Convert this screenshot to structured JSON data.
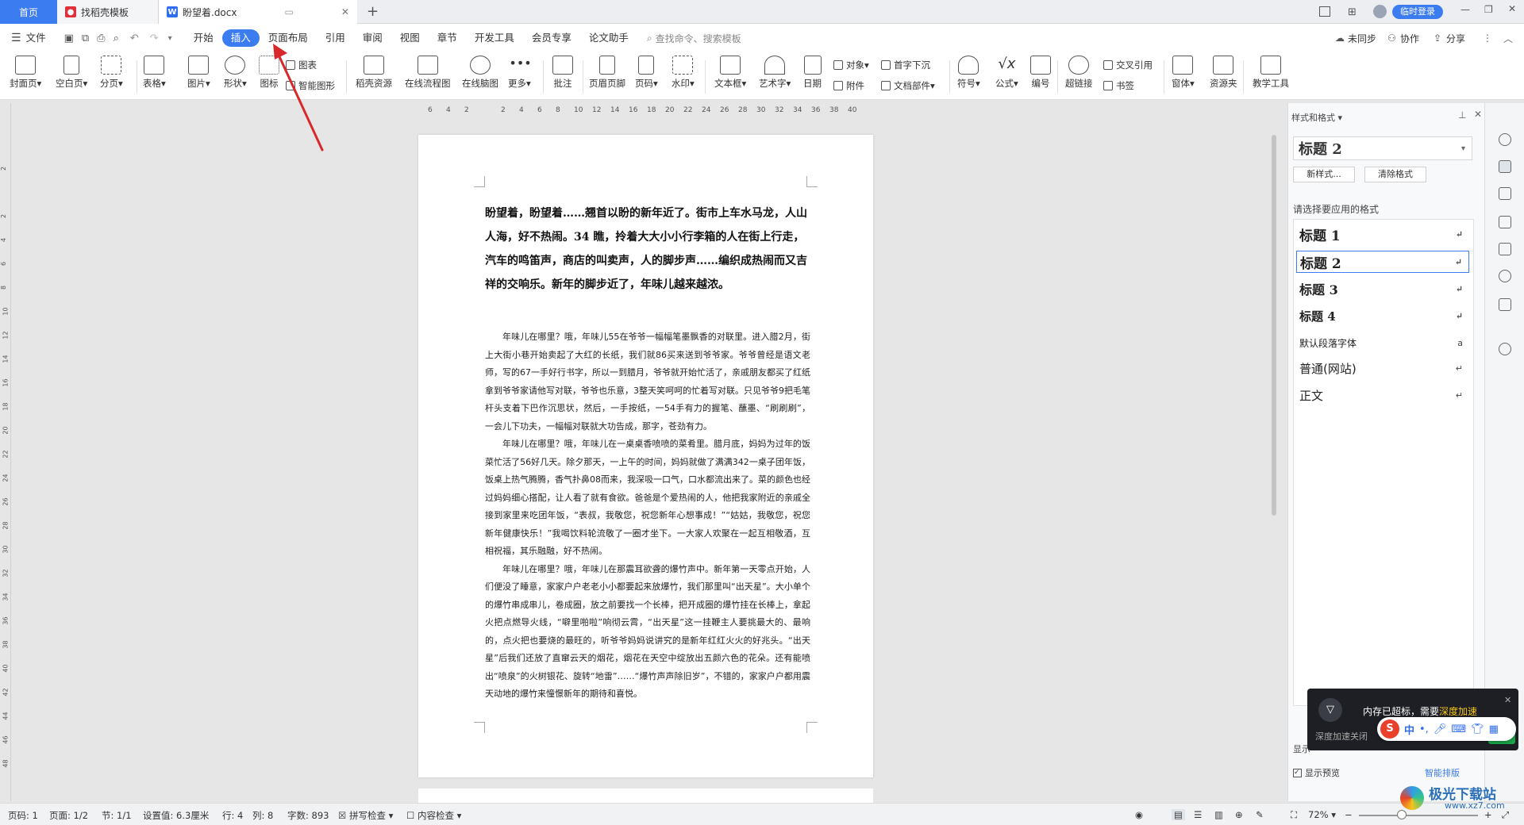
{
  "tabs": [
    {
      "label": "首页"
    },
    {
      "label": "找稻壳模板"
    },
    {
      "label": "盼望着.docx"
    }
  ],
  "titlebar": {
    "login_label": "临时登录",
    "new_tab": "+"
  },
  "menubar": {
    "file": "文件",
    "items": [
      "开始",
      "插入",
      "页面布局",
      "引用",
      "审阅",
      "视图",
      "章节",
      "开发工具",
      "会员专享",
      "论文助手"
    ],
    "active": "插入",
    "search_placeholder": "查找命令、搜索模板",
    "sync": "未同步",
    "collab": "协作",
    "share": "分享"
  },
  "ribbon": {
    "big": [
      {
        "label": "封面页"
      },
      {
        "label": "空白页"
      },
      {
        "label": "分页"
      },
      {
        "label": "表格"
      },
      {
        "label": "图片"
      },
      {
        "label": "形状"
      },
      {
        "label": "图标"
      },
      {
        "label": "稻壳资源"
      },
      {
        "label": "在线流程图"
      },
      {
        "label": "在线脑图"
      },
      {
        "label": "更多"
      },
      {
        "label": "批注"
      },
      {
        "label": "页眉页脚"
      },
      {
        "label": "页码"
      },
      {
        "label": "水印"
      },
      {
        "label": "文本框"
      },
      {
        "label": "艺术字"
      },
      {
        "label": "日期"
      },
      {
        "label": "符号"
      },
      {
        "label": "公式"
      },
      {
        "label": "编号"
      },
      {
        "label": "超链接"
      },
      {
        "label": "窗体"
      },
      {
        "label": "资源夹"
      },
      {
        "label": "教学工具"
      }
    ],
    "small": {
      "chart": "图表",
      "smart_shape": "智能图形",
      "object": "对象",
      "drop_cap": "首字下沉",
      "attachment": "附件",
      "doc_parts": "文档部件",
      "cross_ref": "交叉引用",
      "bookmark": "书签"
    }
  },
  "ruler": {
    "ticks": [
      "6",
      "4",
      "2",
      "",
      "2",
      "4",
      "6",
      "8",
      "10",
      "12",
      "14",
      "16",
      "18",
      "20",
      "22",
      "24",
      "26",
      "28",
      "30",
      "32",
      "34",
      "36",
      "38",
      "40"
    ],
    "vticks": [
      "2",
      "",
      "2",
      "4",
      "6",
      "8",
      "10",
      "12",
      "14",
      "16",
      "18",
      "20",
      "22",
      "24",
      "26",
      "28",
      "30",
      "32",
      "34",
      "36",
      "38",
      "40",
      "42",
      "44",
      "46",
      "48"
    ]
  },
  "document": {
    "title": "盼望着，盼望着……翘首以盼的新年近了。街市上车水马龙，人山人海，好不热闹。34 瞧，拎着大大小小行李箱的人在街上行走，汽车的鸣笛声，商店的叫卖声，人的脚步声……编织成热闹而又吉祥的交响乐。新年的脚步近了，年味儿越来越浓。",
    "paragraphs": [
      "年味儿在哪里？哦，年味儿55在爷爷一幅幅笔墨飘香的对联里。进入腊2月，街上大街小巷开始卖起了大红的长纸，我们就86买来送到爷爷家。爷爷曾经是语文老师，写的67一手好行书字，所以一到腊月，爷爷就开始忙活了，亲戚朋友都买了红纸拿到爷爷家请他写对联，爷爷也乐意，3整天笑呵呵的忙着写对联。只见爷爷9把毛笔杆头支着下巴作沉思状，然后，一手按纸，一54手有力的握笔、蘸墨、“刷刷刷”，一会儿下功夫，一幅幅对联就大功告成，那字，苍劲有力。",
      "年味儿在哪里？哦，年味儿在一桌桌香喷喷的菜肴里。腊月底，妈妈为过年的饭菜忙活了56好几天。除夕那天，一上午的时间，妈妈就做了满满342一桌子团年饭，饭桌上热气腾腾，香气扑鼻08而来，我深吸一口气，口水都流出来了。菜的颜色也经过妈妈细心搭配，让人看了就有食欲。爸爸是个爱热闹的人，他把我家附近的亲戚全接到家里来吃团年饭，“表叔，我敬您，祝您新年心想事成！”“姑姑，我敬您，祝您新年健康快乐！”我喝饮料轮流敬了一圈才坐下。一大家人欢聚在一起互相敬酒，互相祝福，其乐融融，好不热闹。",
      "年味儿在哪里？哦，年味儿在那震耳欲聋的爆竹声中。新年第一天零点开始，人们便没了睡意，家家户户老老小小都要起来放爆竹，我们那里叫“出天星”。大小单个的爆竹串成串儿，卷成圈，放之前要找一个长棒，把开成圈的爆竹挂在长棒上，拿起火把点燃导火线，“噼里啪啦”响彻云霄，“出天星”这一挂鞭主人要挑最大的、最响的，点火把也要烧的最旺的，听爷爷妈妈说讲究的是新年红红火火的好兆头。“出天星”后我们还放了直窜云天的烟花，烟花在天空中绽放出五颜六色的花朵。还有能喷出“喷泉”的火树银花、旋转“地雷”……“爆竹声声除旧岁”，不错的，家家户户都用震天动地的爆竹来憧憬新年的期待和喜悦。"
    ]
  },
  "panel": {
    "title": "样式和格式",
    "current_style": "标题 2",
    "new_style": "新样式...",
    "clear_format": "清除格式",
    "section_label": "请选择要应用的格式",
    "styles": [
      {
        "name": "标题 1"
      },
      {
        "name": "标题 2"
      },
      {
        "name": "标题 3"
      },
      {
        "name": "标题 4"
      },
      {
        "name": "默认段落字体"
      },
      {
        "name": "普通(网站)"
      },
      {
        "name": "正文"
      }
    ],
    "show_label": "显示",
    "preview": "显示预览",
    "smart_layout": "智能排版"
  },
  "toast": {
    "message": "内存已超标，需要",
    "highlight": "深度加速",
    "sub": "深度加速关闭",
    "speed": "速"
  },
  "ime": {
    "lang": "中",
    "symbols": "•,"
  },
  "status": {
    "page_code": "页码: 1",
    "page": "页面: 1/2",
    "section": "节: 1/1",
    "setting": "设置值: 6.3厘米",
    "row": "行: 4",
    "col": "列: 8",
    "words": "字数: 893",
    "spell": "拼写检查",
    "content_check": "内容检查",
    "zoom": "72%"
  },
  "watermark": {
    "site": "极光下载站",
    "url": "www.xz7.com"
  },
  "colors": {
    "accent": "#3b7cf0",
    "red": "#d42020",
    "arrow": "#d9282b"
  }
}
